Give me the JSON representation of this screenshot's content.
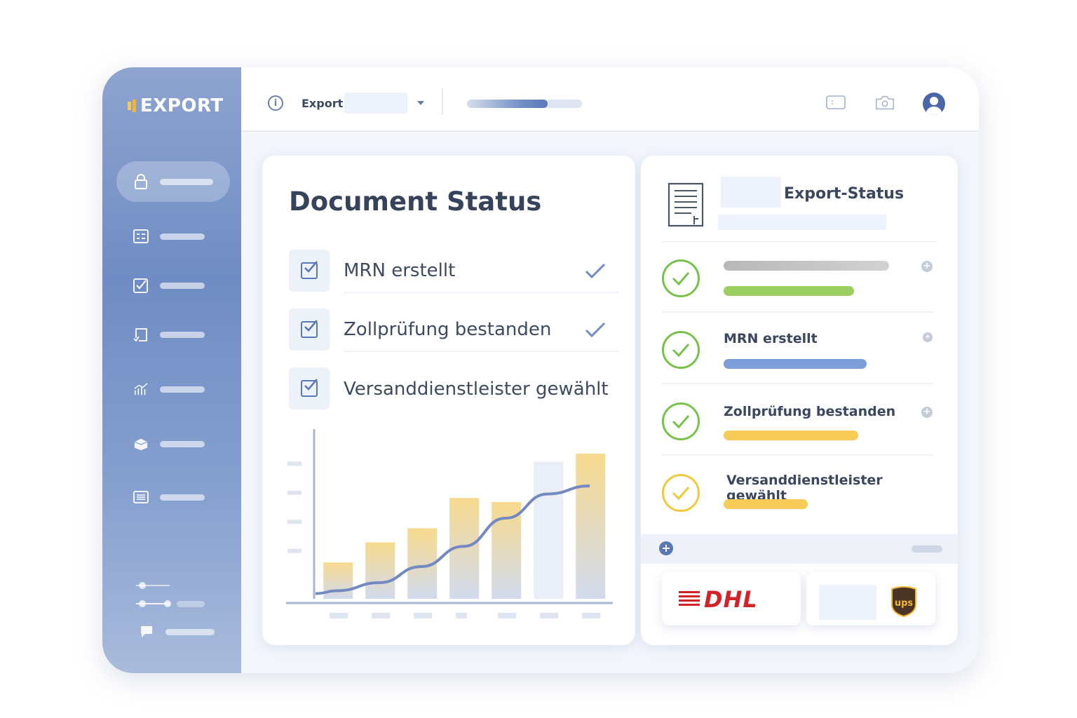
{
  "app": {
    "logo_text": "EXPORT"
  },
  "topbar": {
    "export_label": "Export",
    "progress": 0.7
  },
  "document_status": {
    "title": "Document Status",
    "items": [
      {
        "label": "MRN erstellt",
        "checked": true,
        "done": true
      },
      {
        "label": "Zollprüfung bestanden",
        "checked": true,
        "done": true
      },
      {
        "label": "Versanddienstleister gewählt",
        "checked": true,
        "done": false
      }
    ]
  },
  "chart_data": {
    "type": "bar",
    "title": "",
    "xlabel": "",
    "ylabel": "",
    "categories": [
      "",
      "",
      "",
      "",
      "",
      "",
      ""
    ],
    "series": [
      {
        "values": [
          18,
          28,
          35,
          50,
          48,
          68,
          72
        ]
      }
    ],
    "trend_line": [
      4,
      8,
      16,
      26,
      40,
      52,
      56
    ],
    "ylim": [
      0,
      80
    ],
    "grid": false,
    "colors": {
      "bar": "#f6d37a",
      "bar_fade": "#c9d3ea",
      "line": "#7289c1",
      "axis": "#aab7d1"
    }
  },
  "export_status": {
    "title": "Export-Status",
    "rows": [
      {
        "label": "",
        "status": "done",
        "bar_color": "#9ccf62",
        "bar_width": 0.62
      },
      {
        "label": "MRN erstellt",
        "status": "done",
        "bar_color": "#7d9fd9",
        "bar_width": 0.68
      },
      {
        "label": "Zollprüfung bestanden",
        "status": "done",
        "bar_color": "#f7cb58",
        "bar_width": 0.64
      },
      {
        "label": "Versanddienstleister gewählt",
        "status": "pending",
        "bar_color": "#f7cb58",
        "bar_width": 0.4
      }
    ]
  },
  "carriers": {
    "dhl": "DHL",
    "ups": "ups"
  },
  "colors": {
    "accent": "#5a78b6",
    "success": "#76c24a",
    "pending": "#f3c93a",
    "dhl_red": "#d2232a",
    "ups_brown": "#4a3425",
    "ups_gold": "#f2b531"
  }
}
